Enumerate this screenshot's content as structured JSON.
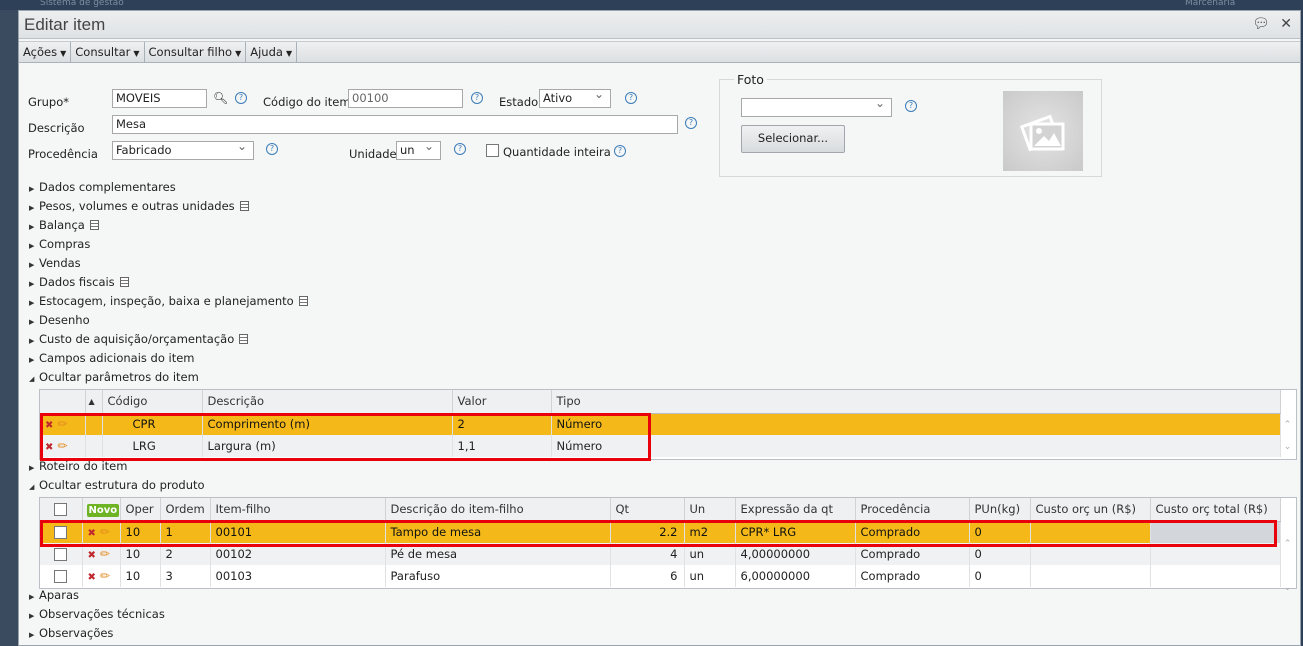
{
  "background": {
    "app_title": "Sistema de gestão",
    "company": "Marcenaria"
  },
  "dialog": {
    "title": "Editar item"
  },
  "toolbar": [
    "Ações",
    "Consultar",
    "Consultar filho",
    "Ajuda"
  ],
  "form": {
    "grupo_label": "Grupo*",
    "grupo_value": "MOVEIS",
    "codigo_label": "Código do item",
    "codigo_value": "00100",
    "estado_label": "Estado",
    "estado_value": "Ativo",
    "descricao_label": "Descrição",
    "descricao_value": "Mesa",
    "procedencia_label": "Procedência",
    "procedencia_value": "Fabricado",
    "unidade_label": "Unidade",
    "unidade_value": "un",
    "quantidade_inteira_label": "Quantidade inteira",
    "quantidade_inteira_checked": false,
    "help": "?"
  },
  "foto": {
    "legend": "Foto",
    "select_value": "",
    "select_button": "Selecionar..."
  },
  "sections": [
    {
      "label": "Dados complementares",
      "doc": false
    },
    {
      "label": "Pesos, volumes e outras unidades",
      "doc": true
    },
    {
      "label": "Balança",
      "doc": true
    },
    {
      "label": "Compras",
      "doc": false
    },
    {
      "label": "Vendas",
      "doc": false
    },
    {
      "label": "Dados fiscais",
      "doc": true
    },
    {
      "label": "Estocagem, inspeção, baixa e planejamento",
      "doc": true
    },
    {
      "label": "Desenho",
      "doc": false
    },
    {
      "label": "Custo de aquisição/orçamentação",
      "doc": true
    },
    {
      "label": "Campos adicionais do item",
      "doc": false
    }
  ],
  "params": {
    "section_label": "Ocultar parâmetros do item",
    "columns": [
      "Código",
      "Descrição",
      "Valor",
      "Tipo"
    ],
    "rows": [
      {
        "codigo": "CPR",
        "descricao": "Comprimento (m)",
        "valor": "2",
        "tipo": "Número"
      },
      {
        "codigo": "LRG",
        "descricao": "Largura (m)",
        "valor": "1,1",
        "tipo": "Número"
      }
    ]
  },
  "roteiro_label": "Roteiro do item",
  "estrutura": {
    "section_label": "Ocultar estrutura do produto",
    "novo_label": "Novo",
    "columns": [
      "Oper",
      "Ordem",
      "Item-filho",
      "Descrição do item-filho",
      "Qt",
      "Un",
      "Expressão da qt",
      "Procedência",
      "PUn(kg)",
      "Custo orç un (R$)",
      "Custo orç total (R$)"
    ],
    "rows": [
      {
        "oper": "10",
        "ordem": "1",
        "item": "00101",
        "descricao": "Tampo de mesa",
        "qt": "2.2",
        "un": "m2",
        "expr": "CPR* LRG",
        "proc": "Comprado",
        "pun": "0",
        "custo_un": "",
        "custo_total": ""
      },
      {
        "oper": "10",
        "ordem": "2",
        "item": "00102",
        "descricao": "Pé de mesa",
        "qt": "4",
        "un": "un",
        "expr": "4,00000000",
        "proc": "Comprado",
        "pun": "0",
        "custo_un": "",
        "custo_total": ""
      },
      {
        "oper": "10",
        "ordem": "3",
        "item": "00103",
        "descricao": "Parafuso",
        "qt": "6",
        "un": "un",
        "expr": "6,00000000",
        "proc": "Comprado",
        "pun": "0",
        "custo_un": "",
        "custo_total": ""
      }
    ]
  },
  "bottom_sections": [
    "Aparas",
    "Observações técnicas",
    "Observações"
  ],
  "colors": {
    "highlight": "#f4b919",
    "annotation": "#e8000b",
    "novo": "#6db324"
  }
}
